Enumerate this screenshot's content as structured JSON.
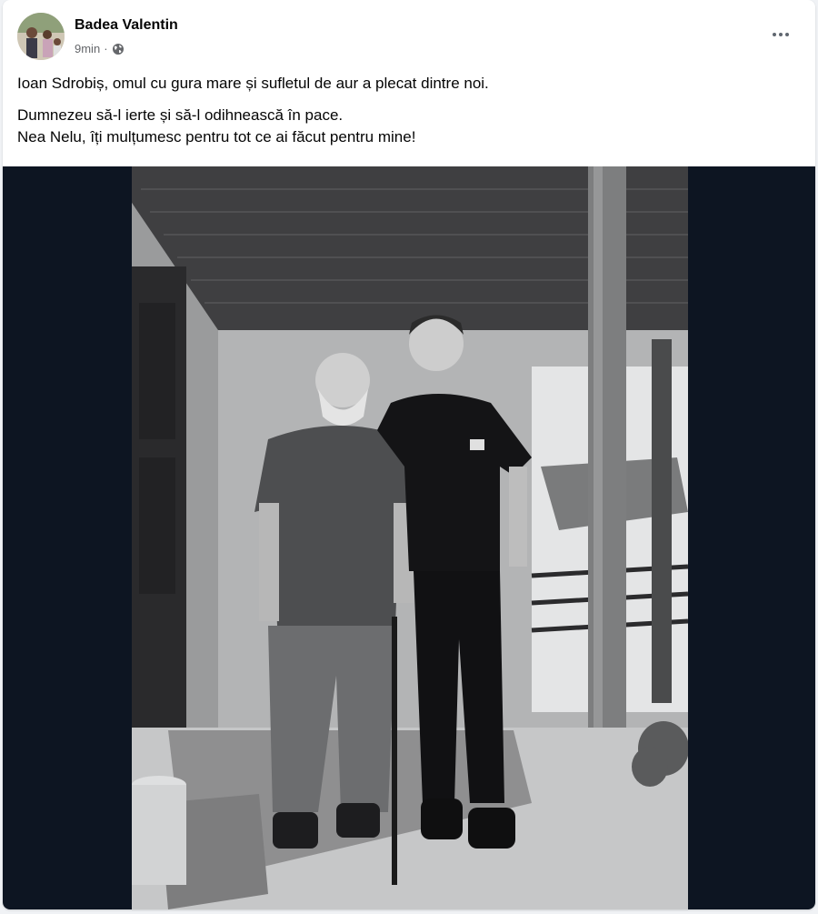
{
  "post": {
    "author": "Badea Valentin",
    "time": "9min",
    "separator": "·",
    "privacy_icon": "globe-icon",
    "more_icon": "more-options-icon",
    "text_line1": "Ioan Sdrobiș, omul cu gura mare și sufletul de aur a plecat dintre noi.",
    "text_line2": "Dumnezeu să-l ierte și să-l odihnească în pace.",
    "text_line3": "Nea Nelu, îți mulțumesc pentru tot ce ai făcut pentru mine!"
  },
  "colors": {
    "author_text": "#050505",
    "meta_text": "#65676b",
    "photo_letterbox": "#0d1522"
  }
}
